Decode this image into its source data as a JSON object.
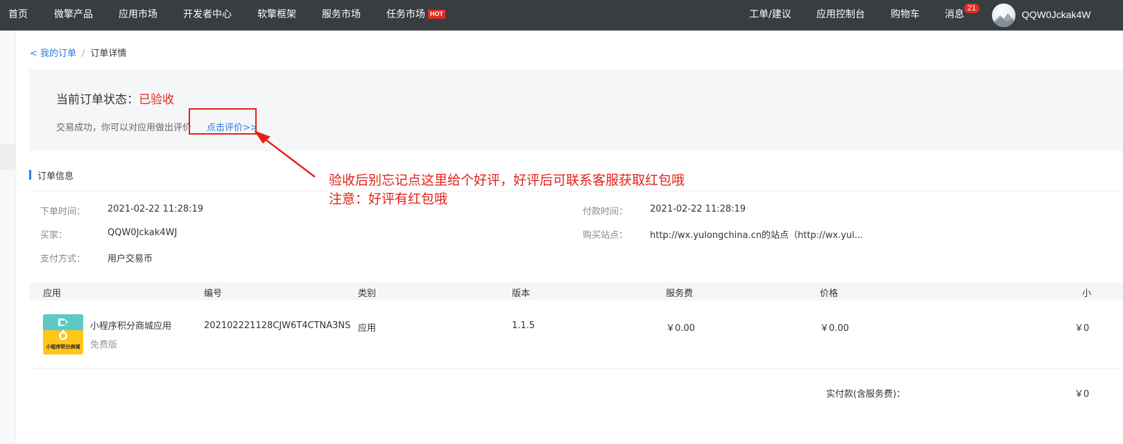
{
  "nav": {
    "home": "首页",
    "products": "微擎产品",
    "app_market": "应用市场",
    "dev_center": "开发者中心",
    "framework": "软擎框架",
    "service_market": "服务市场",
    "task_market": "任务市场",
    "hot_badge": "HOT",
    "ticket": "工单/建议",
    "console": "应用控制台",
    "cart": "购物车",
    "messages": "消息",
    "message_count": "21",
    "username": "QQW0Jckak4W"
  },
  "breadcrumb": {
    "back_link": "< 我的订单",
    "separator": "/",
    "current": "订单详情"
  },
  "status": {
    "label": "当前订单状态：",
    "value": "已验收",
    "hint": "交易成功，你可以对应用做出评价",
    "review_link": "点击评价>>"
  },
  "annotation": {
    "line1": "验收后别忘记点这里给个好评，好评后可联系客服获取红包哦",
    "line2": "注意：好评有红包哦"
  },
  "order_info": {
    "title": "订单信息",
    "order_time_label": "下单时间：",
    "order_time": "2021-02-22 11:28:19",
    "pay_time_label": "付款时间：",
    "pay_time": "2021-02-22 11:28:19",
    "buyer_label": "买家：",
    "buyer": "QQW0Jckak4WJ",
    "site_label": "购买站点：",
    "site": "http://wx.yulongchina.cn的站点（http://wx.yul...",
    "payment_label": "支付方式：",
    "payment": "用户交易币"
  },
  "table": {
    "headers": [
      "应用",
      "编号",
      "类别",
      "版本",
      "服务费",
      "价格",
      "小"
    ],
    "row": {
      "app_name": "小程序积分商城应用",
      "edition": "免费版",
      "icon_text": "小程序积分商城",
      "number": "202102221128CJW6T4CTNA3NS",
      "category": "应用",
      "version": "1.1.5",
      "service_fee": "￥0.00",
      "price": "￥0.00",
      "subtotal": "￥0"
    },
    "total_label": "实付款(含服务费)：",
    "total_value": "￥0"
  },
  "colors": {
    "nav_bg": "#373d41",
    "link": "#2a7ae2",
    "status_red": "#e0281c",
    "annotation_red": "#e32118"
  }
}
